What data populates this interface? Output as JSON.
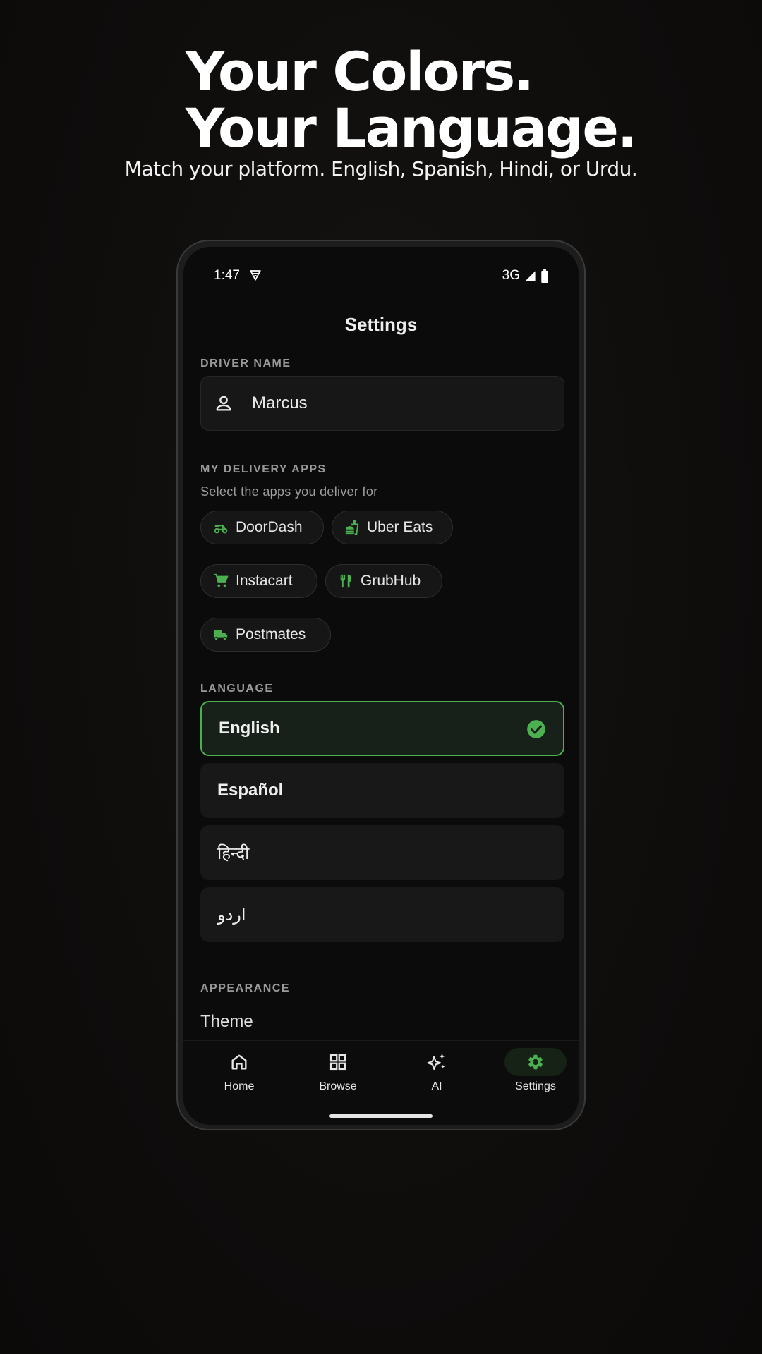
{
  "headline": {
    "line1": "Your Colors.",
    "line2": "Your Language.",
    "subline": "Match your platform. English, Spanish, Hindi, or Urdu."
  },
  "status": {
    "time": "1:47",
    "network": "3G"
  },
  "screen": {
    "title": "Settings"
  },
  "driver": {
    "label": "DRIVER NAME",
    "value": "Marcus"
  },
  "apps": {
    "label": "MY DELIVERY APPS",
    "helper": "Select the apps you deliver for",
    "items": [
      {
        "label": "DoorDash",
        "icon": "scooter-icon"
      },
      {
        "label": "Uber Eats",
        "icon": "fastfood-icon"
      },
      {
        "label": "Instacart",
        "icon": "cart-icon"
      },
      {
        "label": "GrubHub",
        "icon": "utensils-icon"
      },
      {
        "label": "Postmates",
        "icon": "truck-icon"
      }
    ]
  },
  "language": {
    "label": "LANGUAGE",
    "options": [
      {
        "label": "English",
        "selected": true
      },
      {
        "label": "Español",
        "selected": false
      },
      {
        "label": "हिन्दी",
        "selected": false
      },
      {
        "label": "اردو",
        "selected": false
      }
    ]
  },
  "appearance": {
    "label": "APPEARANCE",
    "theme_label": "Theme"
  },
  "nav": [
    {
      "label": "Home",
      "icon": "home-icon",
      "active": false
    },
    {
      "label": "Browse",
      "icon": "grid-icon",
      "active": false
    },
    {
      "label": "AI",
      "icon": "sparkles-icon",
      "active": false
    },
    {
      "label": "Settings",
      "icon": "gear-icon",
      "active": true
    }
  ],
  "colors": {
    "accent": "#4caf50",
    "background": "#0b0b0b",
    "surface": "#181818"
  }
}
